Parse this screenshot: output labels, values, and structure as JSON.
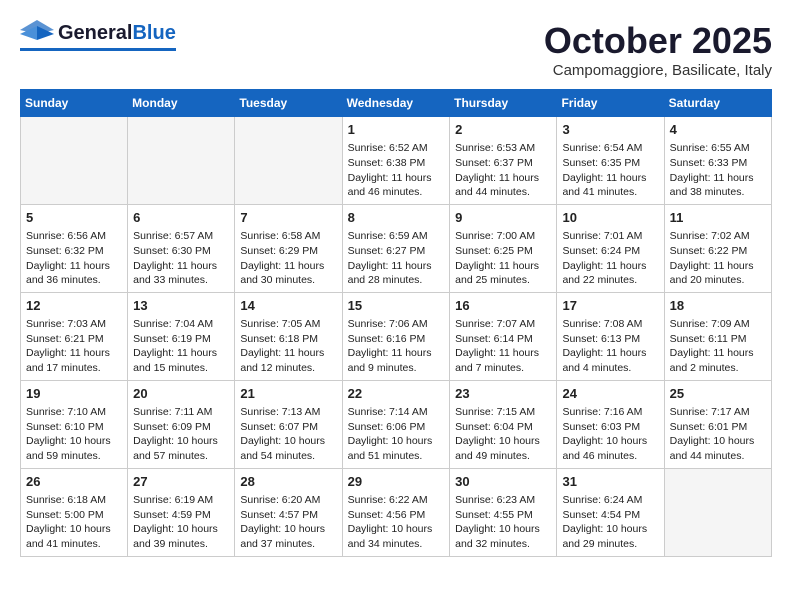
{
  "header": {
    "logo_general": "General",
    "logo_blue": "Blue",
    "month_title": "October 2025",
    "location": "Campomaggiore, Basilicate, Italy"
  },
  "weekdays": [
    "Sunday",
    "Monday",
    "Tuesday",
    "Wednesday",
    "Thursday",
    "Friday",
    "Saturday"
  ],
  "weeks": [
    [
      {
        "day": "",
        "text": ""
      },
      {
        "day": "",
        "text": ""
      },
      {
        "day": "",
        "text": ""
      },
      {
        "day": "1",
        "text": "Sunrise: 6:52 AM\nSunset: 6:38 PM\nDaylight: 11 hours\nand 46 minutes."
      },
      {
        "day": "2",
        "text": "Sunrise: 6:53 AM\nSunset: 6:37 PM\nDaylight: 11 hours\nand 44 minutes."
      },
      {
        "day": "3",
        "text": "Sunrise: 6:54 AM\nSunset: 6:35 PM\nDaylight: 11 hours\nand 41 minutes."
      },
      {
        "day": "4",
        "text": "Sunrise: 6:55 AM\nSunset: 6:33 PM\nDaylight: 11 hours\nand 38 minutes."
      }
    ],
    [
      {
        "day": "5",
        "text": "Sunrise: 6:56 AM\nSunset: 6:32 PM\nDaylight: 11 hours\nand 36 minutes."
      },
      {
        "day": "6",
        "text": "Sunrise: 6:57 AM\nSunset: 6:30 PM\nDaylight: 11 hours\nand 33 minutes."
      },
      {
        "day": "7",
        "text": "Sunrise: 6:58 AM\nSunset: 6:29 PM\nDaylight: 11 hours\nand 30 minutes."
      },
      {
        "day": "8",
        "text": "Sunrise: 6:59 AM\nSunset: 6:27 PM\nDaylight: 11 hours\nand 28 minutes."
      },
      {
        "day": "9",
        "text": "Sunrise: 7:00 AM\nSunset: 6:25 PM\nDaylight: 11 hours\nand 25 minutes."
      },
      {
        "day": "10",
        "text": "Sunrise: 7:01 AM\nSunset: 6:24 PM\nDaylight: 11 hours\nand 22 minutes."
      },
      {
        "day": "11",
        "text": "Sunrise: 7:02 AM\nSunset: 6:22 PM\nDaylight: 11 hours\nand 20 minutes."
      }
    ],
    [
      {
        "day": "12",
        "text": "Sunrise: 7:03 AM\nSunset: 6:21 PM\nDaylight: 11 hours\nand 17 minutes."
      },
      {
        "day": "13",
        "text": "Sunrise: 7:04 AM\nSunset: 6:19 PM\nDaylight: 11 hours\nand 15 minutes."
      },
      {
        "day": "14",
        "text": "Sunrise: 7:05 AM\nSunset: 6:18 PM\nDaylight: 11 hours\nand 12 minutes."
      },
      {
        "day": "15",
        "text": "Sunrise: 7:06 AM\nSunset: 6:16 PM\nDaylight: 11 hours\nand 9 minutes."
      },
      {
        "day": "16",
        "text": "Sunrise: 7:07 AM\nSunset: 6:14 PM\nDaylight: 11 hours\nand 7 minutes."
      },
      {
        "day": "17",
        "text": "Sunrise: 7:08 AM\nSunset: 6:13 PM\nDaylight: 11 hours\nand 4 minutes."
      },
      {
        "day": "18",
        "text": "Sunrise: 7:09 AM\nSunset: 6:11 PM\nDaylight: 11 hours\nand 2 minutes."
      }
    ],
    [
      {
        "day": "19",
        "text": "Sunrise: 7:10 AM\nSunset: 6:10 PM\nDaylight: 10 hours\nand 59 minutes."
      },
      {
        "day": "20",
        "text": "Sunrise: 7:11 AM\nSunset: 6:09 PM\nDaylight: 10 hours\nand 57 minutes."
      },
      {
        "day": "21",
        "text": "Sunrise: 7:13 AM\nSunset: 6:07 PM\nDaylight: 10 hours\nand 54 minutes."
      },
      {
        "day": "22",
        "text": "Sunrise: 7:14 AM\nSunset: 6:06 PM\nDaylight: 10 hours\nand 51 minutes."
      },
      {
        "day": "23",
        "text": "Sunrise: 7:15 AM\nSunset: 6:04 PM\nDaylight: 10 hours\nand 49 minutes."
      },
      {
        "day": "24",
        "text": "Sunrise: 7:16 AM\nSunset: 6:03 PM\nDaylight: 10 hours\nand 46 minutes."
      },
      {
        "day": "25",
        "text": "Sunrise: 7:17 AM\nSunset: 6:01 PM\nDaylight: 10 hours\nand 44 minutes."
      }
    ],
    [
      {
        "day": "26",
        "text": "Sunrise: 6:18 AM\nSunset: 5:00 PM\nDaylight: 10 hours\nand 41 minutes."
      },
      {
        "day": "27",
        "text": "Sunrise: 6:19 AM\nSunset: 4:59 PM\nDaylight: 10 hours\nand 39 minutes."
      },
      {
        "day": "28",
        "text": "Sunrise: 6:20 AM\nSunset: 4:57 PM\nDaylight: 10 hours\nand 37 minutes."
      },
      {
        "day": "29",
        "text": "Sunrise: 6:22 AM\nSunset: 4:56 PM\nDaylight: 10 hours\nand 34 minutes."
      },
      {
        "day": "30",
        "text": "Sunrise: 6:23 AM\nSunset: 4:55 PM\nDaylight: 10 hours\nand 32 minutes."
      },
      {
        "day": "31",
        "text": "Sunrise: 6:24 AM\nSunset: 4:54 PM\nDaylight: 10 hours\nand 29 minutes."
      },
      {
        "day": "",
        "text": ""
      }
    ]
  ]
}
